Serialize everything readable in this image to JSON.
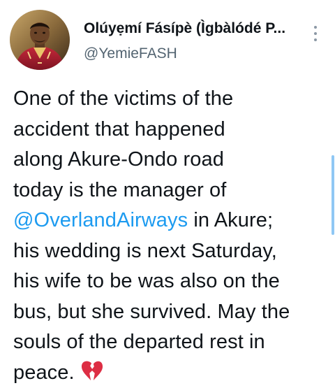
{
  "tweet": {
    "author": {
      "display_name": "Olúyẹmí Fásípè (Ìgbàlódé P...",
      "handle": "@YemieFASH",
      "avatar": "avatar-photo"
    },
    "menu_icon": "more-vertical-icon",
    "body": {
      "line1": "One of the victims of the",
      "line2": "accident that happened",
      "line3": "along Akure-Ondo road",
      "line4": "today is the manager of",
      "mention": "@OverlandAirways",
      "line5_after_mention": " in Akure;",
      "line6": "his wedding is next Saturday,",
      "line7": "his wife to be was also on the",
      "line8": "bus, but she survived. May the",
      "line9": "souls of the departed rest in",
      "line10": "peace.",
      "emoji": "broken-heart-icon"
    },
    "colors": {
      "text": "#0f1419",
      "secondary": "#536471",
      "link": "#1d9bf0",
      "emoji": "#dd2e44"
    }
  }
}
